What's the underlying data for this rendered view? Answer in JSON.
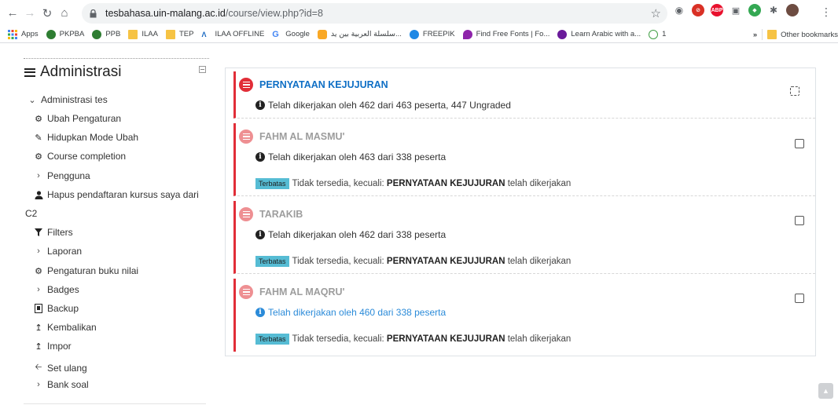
{
  "browser": {
    "url_host": "tesbahasa.uin-malang.ac.id",
    "url_path": "/course/view.php?id=8",
    "bookmarks": [
      {
        "label": "Apps",
        "icon": "apps-grid-icon"
      },
      {
        "label": "PKPBA",
        "icon": "green-logo-icon"
      },
      {
        "label": "PPB",
        "icon": "green-logo-icon"
      },
      {
        "label": "ILAA",
        "icon": "folder-icon"
      },
      {
        "label": "TEP",
        "icon": "folder-icon"
      },
      {
        "label": "ILAA OFFLINE",
        "icon": "ilaa-logo-icon"
      },
      {
        "label": "Google",
        "icon": "google-icon"
      },
      {
        "label": "سلسلة العربية بين يد...",
        "icon": "arabic-site-icon"
      },
      {
        "label": "FREEPIK",
        "icon": "freepik-icon"
      },
      {
        "label": "Find Free Fonts | Fo...",
        "icon": "fonts-site-icon"
      },
      {
        "label": "Learn Arabic with a...",
        "icon": "learn-arabic-icon"
      },
      {
        "label": "1",
        "icon": "circle-site-icon"
      }
    ],
    "more_label": "»",
    "other_bookmarks": "Other bookmarks"
  },
  "sidebar": {
    "title": "Administrasi",
    "items": [
      {
        "label": "Administrasi tes",
        "icon": "chevron-down-icon"
      },
      {
        "label": "Ubah Pengaturan",
        "icon": "gear-icon"
      },
      {
        "label": "Hidupkan Mode Ubah",
        "icon": "pencil-icon"
      },
      {
        "label": "Course completion",
        "icon": "gear-icon"
      },
      {
        "label": "Pengguna",
        "icon": "chevron-right-icon"
      },
      {
        "label": "Hapus pendaftaran kursus saya dari",
        "icon": "user-icon"
      },
      {
        "label": "C2",
        "icon": ""
      },
      {
        "label": "Filters",
        "icon": "filter-icon"
      },
      {
        "label": "Laporan",
        "icon": "chevron-right-icon"
      },
      {
        "label": "Pengaturan buku nilai",
        "icon": "gear-icon"
      },
      {
        "label": "Badges",
        "icon": "chevron-right-icon"
      },
      {
        "label": "Backup",
        "icon": "backup-file-icon"
      },
      {
        "label": "Kembalikan",
        "icon": "upload-icon"
      },
      {
        "label": "Impor",
        "icon": "upload-icon"
      },
      {
        "label": "Set ulang",
        "icon": "arrow-left-icon"
      },
      {
        "label": "Bank soal",
        "icon": "chevron-right-icon"
      }
    ]
  },
  "activities": [
    {
      "title": "PERNYATAAN KEJUJURAN",
      "info": "Telah dikerjakan oleh 462 dari 463 peserta, 447 Ungraded",
      "restriction": null
    },
    {
      "title": "FAHM AL MASMU'",
      "info": "Telah dikerjakan oleh 463 dari 338 peserta",
      "restriction": {
        "badge": "Terbatas",
        "prefix": "Tidak tersedia, kecuali:",
        "bold": "PERNYATAAN KEJUJURAN",
        "suffix": "telah dikerjakan"
      }
    },
    {
      "title": "TARAKIB",
      "info": "Telah dikerjakan oleh 462 dari 338 peserta",
      "restriction": {
        "badge": "Terbatas",
        "prefix": "Tidak tersedia, kecuali:",
        "bold": "PERNYATAAN KEJUJURAN",
        "suffix": "telah dikerjakan"
      }
    },
    {
      "title": "FAHM AL MAQRU'",
      "info": "Telah dikerjakan oleh 460 dari 338 peserta",
      "restriction": {
        "badge": "Terbatas",
        "prefix": "Tidak tersedia, kecuali:",
        "bold": "PERNYATAAN KEJUJURAN",
        "suffix": "telah dikerjakan"
      }
    }
  ],
  "colors": {
    "accent_red": "#e12d37",
    "link_blue": "#0f6fc5",
    "badge_cyan": "#56bcd4"
  }
}
